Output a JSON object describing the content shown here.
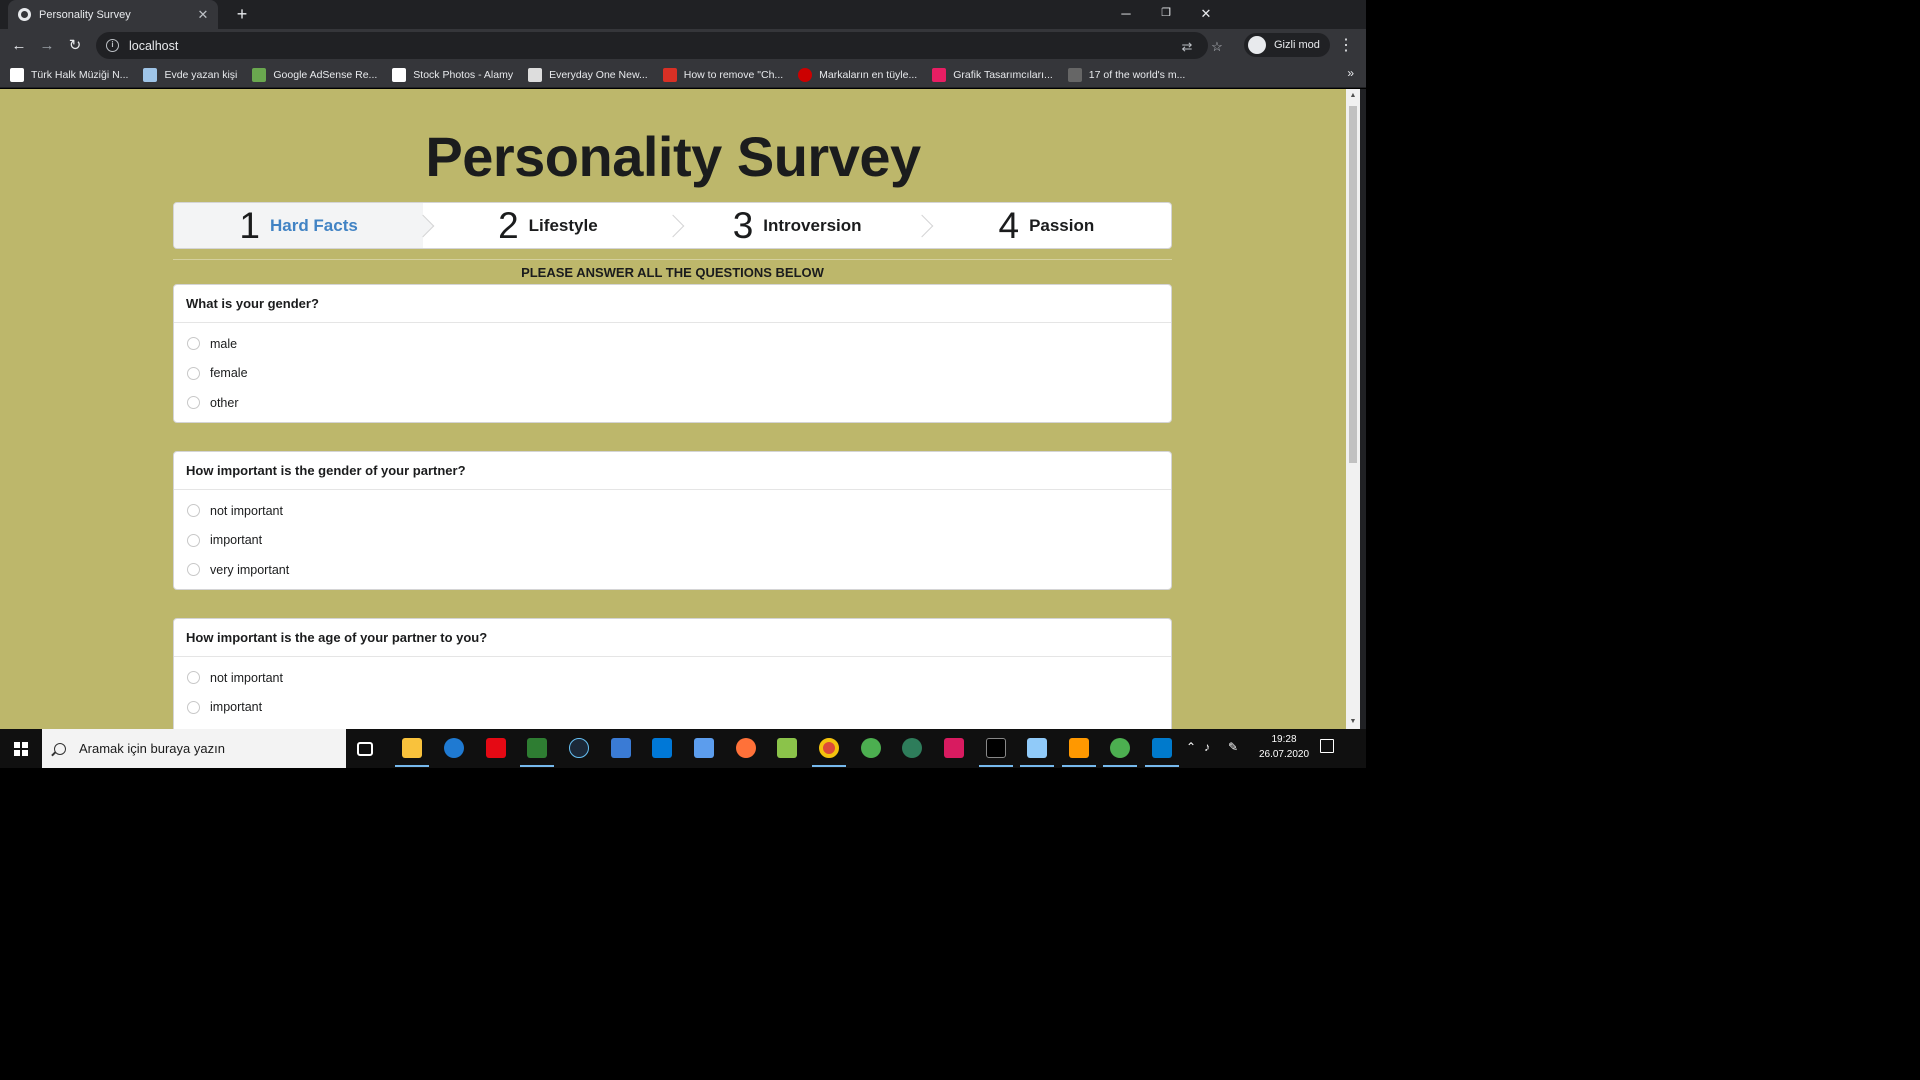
{
  "browser": {
    "tab_title": "Personality Survey",
    "tab_close": "✕",
    "new_tab": "+",
    "url": "localhost",
    "incognito_label": "Gizli mod",
    "bookmarks": [
      {
        "label": "Türk Halk Müziği N...",
        "color": "#ffffff"
      },
      {
        "label": "Evde yazan kişi",
        "color": "#9fc5e8"
      },
      {
        "label": "Google AdSense Re...",
        "color": "#6aa84f"
      },
      {
        "label": "Stock Photos - Alamy",
        "color": "#ffffff"
      },
      {
        "label": "Everyday One New...",
        "color": "#dddddd"
      },
      {
        "label": "How to remove \"Ch...",
        "color": "#d93025"
      },
      {
        "label": "Markaların en tüyle...",
        "color": "#cc0000"
      },
      {
        "label": "Grafik Tasarımcıları...",
        "color": "#e91e63"
      },
      {
        "label": "17 of the world's m...",
        "color": "#666666"
      }
    ],
    "bookmarks_more": "»"
  },
  "page": {
    "title": "Personality Survey",
    "steps": [
      {
        "number": "1",
        "label": "Hard Facts",
        "active": true
      },
      {
        "number": "2",
        "label": "Lifestyle",
        "active": false
      },
      {
        "number": "3",
        "label": "Introversion",
        "active": false
      },
      {
        "number": "4",
        "label": "Passion",
        "active": false
      }
    ],
    "instruction": "PLEASE ANSWER ALL THE QUESTIONS BELOW",
    "questions": [
      {
        "question": "What is your gender?",
        "options": [
          "male",
          "female",
          "other"
        ]
      },
      {
        "question": "How important is the gender of your partner?",
        "options": [
          "not important",
          "important",
          "very important"
        ]
      },
      {
        "question": "How important is the age of your partner to you?",
        "options": [
          "not important",
          "important"
        ]
      }
    ],
    "accent_color": "#4183c4",
    "background_color": "#bdb76b"
  },
  "taskbar": {
    "search_placeholder": "Aramak için buraya yazın",
    "time": "19:28",
    "date": "26.07.2020"
  }
}
